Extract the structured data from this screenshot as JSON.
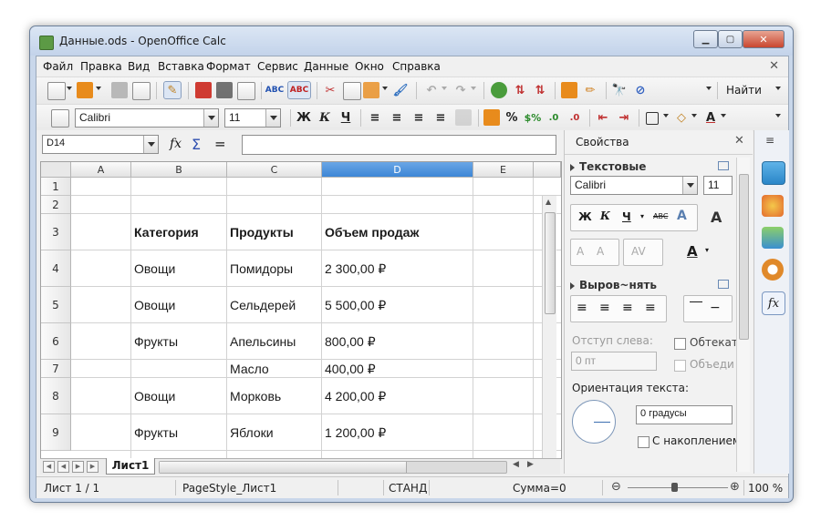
{
  "window": {
    "title": "Данные.ods - OpenOffice Calc"
  },
  "menu": [
    "Файл",
    "Правка",
    "Вид",
    "Вставка",
    "Формат",
    "Сервис",
    "Данные",
    "Окно",
    "Справка"
  ],
  "toolbar": {
    "find_label": "Найти"
  },
  "format": {
    "font_name": "Calibri",
    "font_size": "11",
    "bold": "Ж",
    "italic": "К",
    "underline": "Ч",
    "percent": "%"
  },
  "formula_bar": {
    "cell_ref": "D14",
    "value": ""
  },
  "sheet": {
    "columns": [
      "A",
      "B",
      "C",
      "D",
      "E"
    ],
    "selected_column": "D",
    "rows": [
      {
        "num": "1",
        "b": "",
        "c": "",
        "d": ""
      },
      {
        "num": "2",
        "b": "",
        "c": "",
        "d": ""
      },
      {
        "num": "3",
        "b": "Категория",
        "c": "Продукты",
        "d": "Объем продаж",
        "bold": true
      },
      {
        "num": "4",
        "b": "Овощи",
        "c": "Помидоры",
        "d": "2 300,00 ₽"
      },
      {
        "num": "5",
        "b": "Овощи",
        "c": "Сельдерей",
        "d": "5 500,00 ₽"
      },
      {
        "num": "6",
        "b": "Фрукты",
        "c": "Апельсины",
        "d": "800,00 ₽"
      },
      {
        "num": "7",
        "b": "",
        "c": "Масло",
        "d": "400,00 ₽"
      },
      {
        "num": "8",
        "b": "Овощи",
        "c": "Морковь",
        "d": "4 200,00 ₽"
      },
      {
        "num": "9",
        "b": "Фрукты",
        "c": "Яблоки",
        "d": "1 200,00 ₽"
      }
    ],
    "tab_name": "Лист1"
  },
  "sidebar": {
    "title": "Свойства",
    "text_section": "Текстовые",
    "font_name": "Calibri",
    "font_size": "11",
    "align_section": "Выров~нять",
    "indent_label": "Отступ слева:",
    "indent_value": "0 пт",
    "wrap_label": "Обтекат",
    "merge_label": "Объеди",
    "orientation_label": "Ориентация текста:",
    "orientation_value": "0 градусы",
    "stacked_label": "С накоплением"
  },
  "status": {
    "sheet": "Лист 1 / 1",
    "page_style": "PageStyle_Лист1",
    "mode": "СТАНД",
    "sum": "Сумма=0",
    "zoom": "100 %"
  }
}
